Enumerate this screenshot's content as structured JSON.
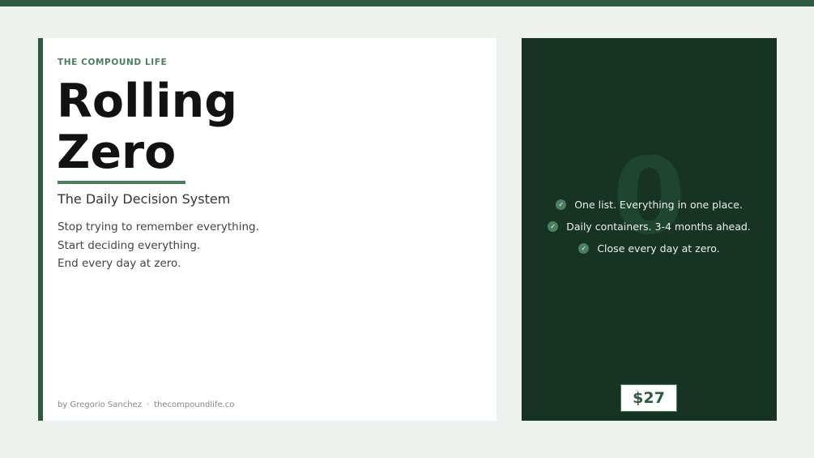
{
  "cover": {
    "brand": "THE COMPOUND LIFE",
    "title_line1": "Rolling",
    "title_line2": "Zero",
    "subtitle": "The Daily Decision System",
    "body_lines": [
      "Stop trying to remember everything.",
      "Start deciding everything.",
      "End every day at zero."
    ],
    "footer": {
      "author": "by Gregorio Sanchez",
      "separator": "·",
      "website": "thecompoundlife.co"
    }
  },
  "panel": {
    "watermark": "0",
    "features": [
      "One list. Everything in one place.",
      "Daily containers. 3-4 months ahead.",
      "Close every day at zero."
    ],
    "check_glyph": "✓",
    "price": "$27"
  },
  "colors": {
    "accent": "#2f5a3d",
    "accent_light": "#4a8060",
    "panel_bg": "#163323",
    "page_bg": "#eef2ee"
  }
}
